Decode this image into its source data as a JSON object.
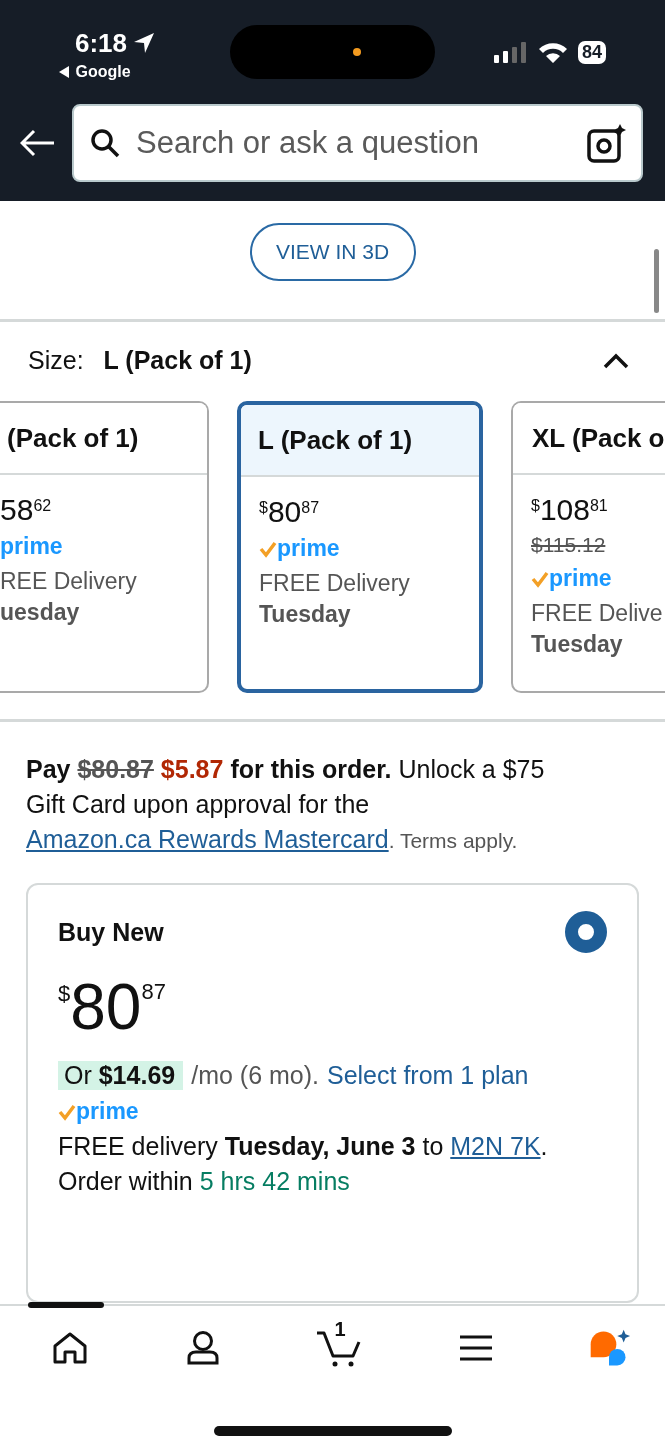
{
  "status_bar": {
    "time": "6:18",
    "back_app": "Google",
    "battery": "84"
  },
  "search": {
    "placeholder": "Search or ask a question"
  },
  "view_3d": {
    "label": "VIEW IN 3D"
  },
  "size": {
    "label": "Size:",
    "value": "L (Pack of 1)",
    "expanded": true
  },
  "size_options": [
    {
      "label": "(Pack of 1)",
      "price_whole": "58",
      "price_fraction": "62",
      "prime": "prime",
      "prime_check": false,
      "delivery": "REE Delivery",
      "day": "uesday",
      "selected": false
    },
    {
      "label": "L (Pack of 1)",
      "currency": "$",
      "price_whole": "80",
      "price_fraction": "87",
      "prime": "prime",
      "prime_check": true,
      "delivery": "FREE Delivery",
      "day": "Tuesday",
      "selected": true
    },
    {
      "label": "XL (Pack o",
      "currency": "$",
      "price_whole": "108",
      "price_fraction": "81",
      "list_price": "$115.12",
      "prime": "prime",
      "prime_check": true,
      "delivery": "FREE Delive",
      "day": "Tuesday",
      "selected": false
    }
  ],
  "promo": {
    "lead": "Pay",
    "old_price": "$80.87",
    "new_price": "$5.87",
    "lead_tail": "for this order.",
    "text": "Unlock a $75 Gift Card upon approval for the",
    "link": "Amazon.ca Rewards Mastercard",
    "terms": ". Terms apply."
  },
  "buy_new": {
    "title": "Buy New",
    "selected": true,
    "currency": "$",
    "price_whole": "80",
    "price_fraction": "87",
    "installment": "Or **$14.69**",
    "installment_tail": "/mo (6 mo).",
    "plan_link": "Select from 1 plan",
    "prime": "prime",
    "delivery": "FREE delivery **Tuesday, June 3** to",
    "postal_link": "M2N 7K",
    "delivery_end": ".",
    "order_within": "Order within",
    "countdown": "5 hrs 42 mins"
  },
  "bottom_nav": [
    {
      "kind": "home"
    },
    {
      "kind": "account"
    },
    {
      "kind": "cart",
      "count": "1"
    },
    {
      "kind": "menu"
    },
    {
      "kind": "assistant"
    }
  ]
}
